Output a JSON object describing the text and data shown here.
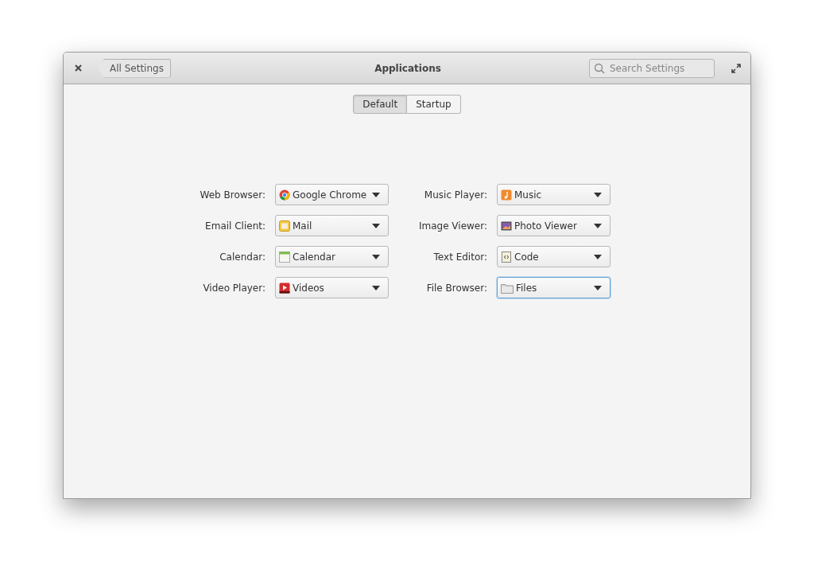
{
  "window": {
    "title": "Applications",
    "back_button": "All Settings",
    "search": {
      "placeholder": "Search Settings"
    }
  },
  "tabs": [
    {
      "label": "Default",
      "selected": true
    },
    {
      "label": "Startup",
      "selected": false
    }
  ],
  "defaults": [
    {
      "label": "Web Browser:",
      "value": "Google Chrome",
      "kind": "chrome",
      "focused": false
    },
    {
      "label": "Music Player:",
      "value": "Music",
      "kind": "music",
      "focused": false
    },
    {
      "label": "Email Client:",
      "value": "Mail",
      "kind": "mail",
      "focused": false
    },
    {
      "label": "Image Viewer:",
      "value": "Photo Viewer",
      "kind": "photo",
      "focused": false
    },
    {
      "label": "Calendar:",
      "value": "Calendar",
      "kind": "calendar",
      "focused": false
    },
    {
      "label": "Text Editor:",
      "value": "Code",
      "kind": "code",
      "focused": false
    },
    {
      "label": "Video Player:",
      "value": "Videos",
      "kind": "video",
      "focused": false
    },
    {
      "label": "File Browser:",
      "value": "Files",
      "kind": "folder",
      "focused": true
    }
  ]
}
